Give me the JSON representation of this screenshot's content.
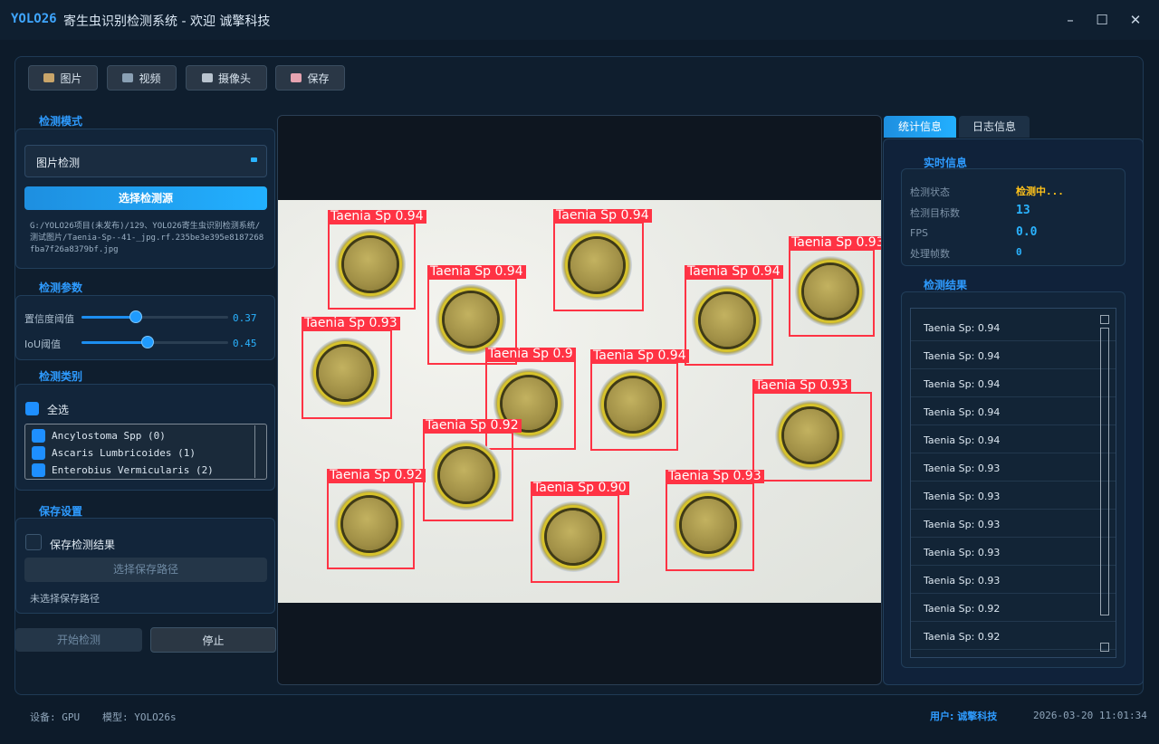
{
  "window": {
    "brand": "YOLO26",
    "title": "寄生虫识别检测系统 - 欢迎 诚擎科技",
    "minimize": "–",
    "maximize": "☐",
    "close": "✕"
  },
  "toolbar": {
    "image": "图片",
    "video": "视频",
    "camera": "摄像头",
    "save": "保存"
  },
  "detect_mode": {
    "title": "检测模式",
    "selected": "图片检测",
    "select_source_button": "选择检测源",
    "path": "G:/YOLO26项目(未发布)/129、YOLO26寄生虫识别检测系统/测试图片/Taenia-Sp--41-_jpg.rf.235be3e395e8187268fba7f26a8379bf.jpg"
  },
  "params": {
    "title": "检测参数",
    "confidence_label": "置信度阈值",
    "confidence_value": "0.37",
    "confidence": 0.37,
    "iou_label": "IoU阈值",
    "iou_value": "0.45",
    "iou": 0.45
  },
  "classes": {
    "title": "检测类别",
    "select_all": "全选",
    "items": [
      "Ancylostoma Spp (0)",
      "Ascaris Lumbricoides (1)",
      "Enterobius Vermicularis (2)"
    ]
  },
  "save_settings": {
    "title": "保存设置",
    "save_results": "保存检测结果",
    "choose_path_button": "选择保存路径",
    "no_path": "未选择保存路径"
  },
  "actions": {
    "start": "开始检测",
    "stop": "停止"
  },
  "detections": [
    {
      "label": "Taenia Sp 0.94"
    },
    {
      "label": "Taenia Sp 0.94"
    },
    {
      "label": "Taenia Sp 0.93"
    },
    {
      "label": "Taenia Sp 0.94"
    },
    {
      "label": "Taenia Sp 0.94"
    },
    {
      "label": "Taenia Sp 0.93"
    },
    {
      "label": "Taenia Sp 0.9"
    },
    {
      "label": "Taenia Sp 0.94"
    },
    {
      "label": "Taenia Sp 0.93"
    },
    {
      "label": "Taenia Sp 0.92"
    },
    {
      "label": "Taenia Sp 0.92"
    },
    {
      "label": "Taenia Sp 0.90"
    },
    {
      "label": "Taenia Sp 0.93"
    }
  ],
  "right": {
    "tab_stats": "统计信息",
    "tab_log": "日志信息",
    "realtime_title": "实时信息",
    "status_label": "检测状态",
    "status_value": "检测中...",
    "count_label": "检测目标数",
    "count_value": "13",
    "fps_label": "FPS",
    "fps_value": "0.0",
    "frames_label": "处理帧数",
    "frames_value": "0",
    "results_title": "检测结果",
    "results": [
      "Taenia Sp: 0.94",
      "Taenia Sp: 0.94",
      "Taenia Sp: 0.94",
      "Taenia Sp: 0.94",
      "Taenia Sp: 0.94",
      "Taenia Sp: 0.93",
      "Taenia Sp: 0.93",
      "Taenia Sp: 0.93",
      "Taenia Sp: 0.93",
      "Taenia Sp: 0.93",
      "Taenia Sp: 0.92",
      "Taenia Sp: 0.92"
    ]
  },
  "statusbar": {
    "device": "设备: GPU",
    "model": "模型: YOLO26s",
    "user": "用户: 诚擎科技",
    "time": "2026-03-20 11:01:34"
  },
  "colors": {
    "accent": "#1e9bff",
    "box": "#ff3344",
    "status": "#ffc21a"
  }
}
